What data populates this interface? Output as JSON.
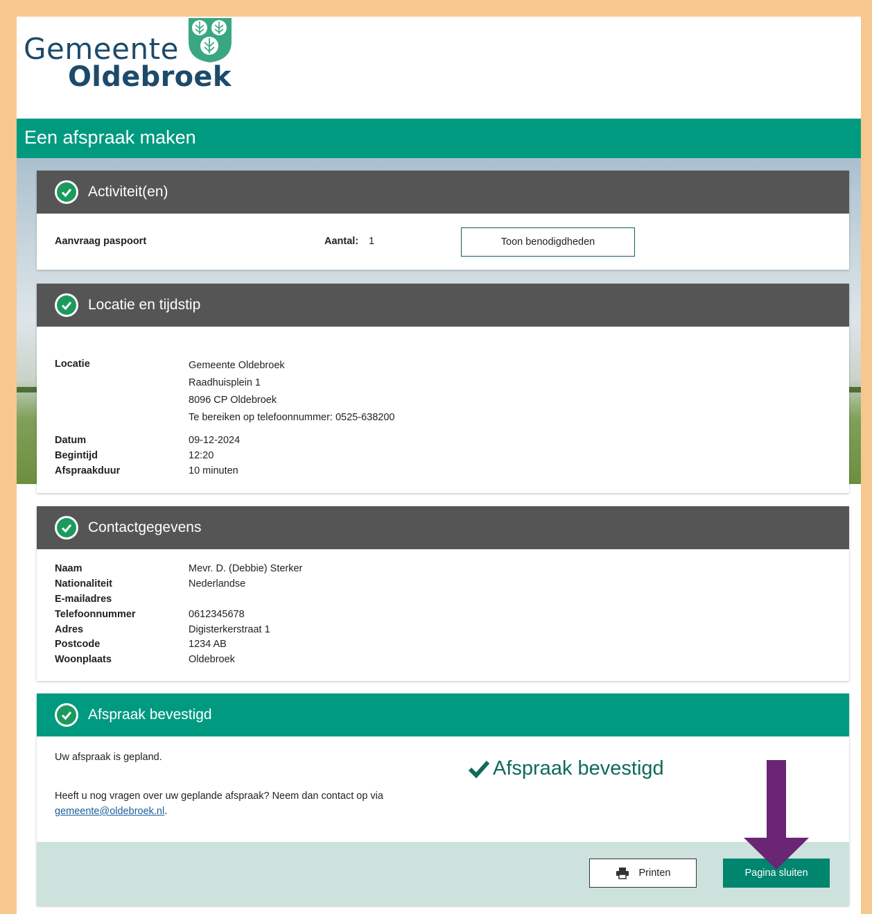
{
  "logo": {
    "line1": "Gemeente",
    "line2": "Oldebroek"
  },
  "page_title": "Een afspraak maken",
  "activities": {
    "title": "Activiteit(en)",
    "item": "Aanvraag paspoort",
    "count_label": "Aantal:",
    "count_value": "1",
    "button": "Toon benodigdheden"
  },
  "location": {
    "title": "Locatie en tijdstip",
    "location_label": "Locatie",
    "location_lines": [
      "Gemeente Oldebroek",
      "Raadhuisplein 1",
      "8096 CP Oldebroek",
      "Te bereiken op telefoonnummer: 0525-638200"
    ],
    "date_label": "Datum",
    "date_value": "09-12-2024",
    "start_label": "Begintijd",
    "start_value": "12:20",
    "duration_label": "Afspraakduur",
    "duration_value": "10 minuten"
  },
  "contact": {
    "title": "Contactgegevens",
    "rows": [
      {
        "label": "Naam",
        "value": "Mevr. D. (Debbie) Sterker"
      },
      {
        "label": "Nationaliteit",
        "value": "Nederlandse"
      },
      {
        "label": "E-mailadres",
        "value": ""
      },
      {
        "label": "Telefoonnummer",
        "value": "0612345678"
      },
      {
        "label": "Adres",
        "value": "Digisterkerstraat 1"
      },
      {
        "label": "Postcode",
        "value": "1234 AB"
      },
      {
        "label": "Woonplaats",
        "value": "Oldebroek"
      }
    ]
  },
  "confirmed": {
    "title": "Afspraak bevestigd",
    "text1": "Uw afspraak is gepland.",
    "text2": "Heeft u nog vragen over uw geplande afspraak? Neem dan contact op via",
    "email": "gemeente@oldebroek.nl",
    "period": ".",
    "big_status": "Afspraak bevestigd",
    "print_button": "Printen",
    "close_button": "Pagina sluiten"
  },
  "colors": {
    "brand_green": "#009a80",
    "dark_header": "#555555",
    "arrow": "#6a2574",
    "frame": "#f6c890"
  },
  "icons": [
    "check-circle-icon",
    "checkmark-icon",
    "printer-icon",
    "arrow-down-icon"
  ]
}
